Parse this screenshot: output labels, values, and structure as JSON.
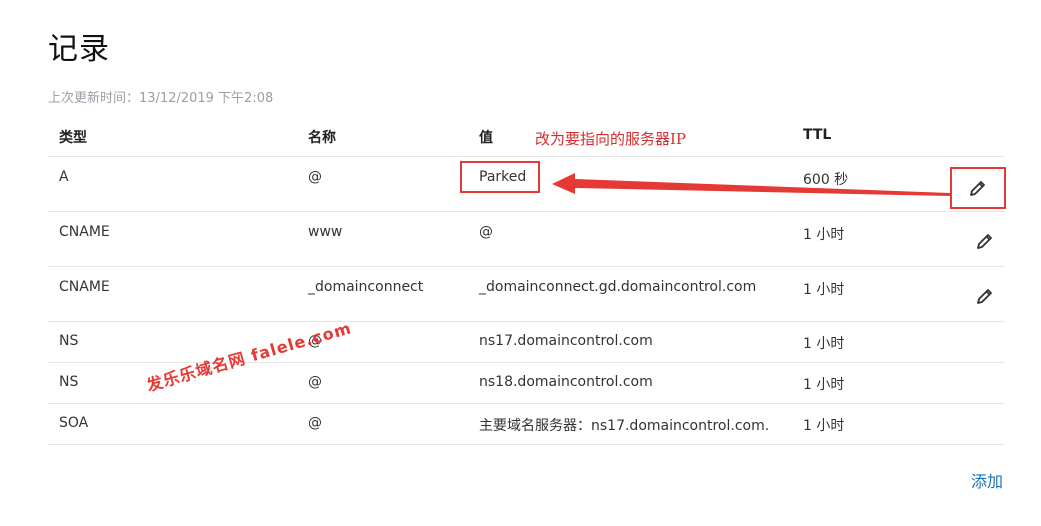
{
  "page": {
    "title": "记录",
    "last_updated_label": "上次更新时间：13/12/2019 下午2:08",
    "add_label": "添加"
  },
  "table": {
    "columns": [
      "类型",
      "名称",
      "值",
      "TTL"
    ],
    "rows": [
      {
        "type": "A",
        "name": "@",
        "value": "Parked",
        "ttl": "600 秒",
        "editable": true
      },
      {
        "type": "CNAME",
        "name": "www",
        "value": "@",
        "ttl": "1 小时",
        "editable": true
      },
      {
        "type": "CNAME",
        "name": "_domainconnect",
        "value": "_domainconnect.gd.domaincontrol.com",
        "ttl": "1 小时",
        "editable": true
      },
      {
        "type": "NS",
        "name": "@",
        "value": "ns17.domaincontrol.com",
        "ttl": "1 小时",
        "editable": false
      },
      {
        "type": "NS",
        "name": "@",
        "value": "ns18.domaincontrol.com",
        "ttl": "1 小时",
        "editable": false
      },
      {
        "type": "SOA",
        "name": "@",
        "value": "主要域名服务器：ns17.domaincontrol.com.",
        "ttl": "1 小时",
        "editable": false
      }
    ]
  },
  "annotation": {
    "text": "改为要指向的服务器IP",
    "color": "#d32f2f"
  },
  "watermark": {
    "text": "发乐乐域名网 falele.com"
  },
  "icons": {
    "edit": "pencil-icon"
  },
  "colors": {
    "link": "#1a73b8",
    "highlight": "#e53935",
    "muted": "#9aa0a6"
  }
}
